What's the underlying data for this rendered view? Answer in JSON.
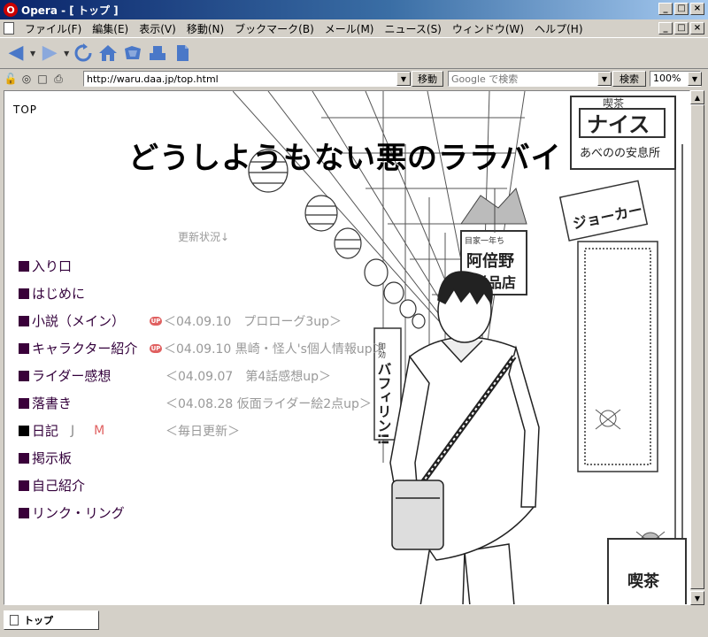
{
  "window": {
    "title": "Opera - [ トップ ]",
    "app_icon_letter": "O",
    "min_glyph": "_",
    "max_glyph": "□",
    "close_glyph": "×"
  },
  "menu": {
    "items": [
      "ファイル(F)",
      "編集(E)",
      "表示(V)",
      "移動(N)",
      "ブックマーク(B)",
      "メール(M)",
      "ニュース(S)",
      "ウィンドウ(W)",
      "ヘルプ(H)"
    ]
  },
  "address_bar": {
    "url": "http://waru.daa.jp/top.html",
    "go_label": "移動",
    "search_placeholder": "Google で検索",
    "search_button": "検索",
    "zoom": "100%"
  },
  "page": {
    "top_label": "TOP",
    "site_title": "どうしようもない悪のララバイ",
    "update_heading": "更新状況↓",
    "nav": [
      {
        "label": "入り口"
      },
      {
        "label": "はじめに"
      },
      {
        "label": "小説（メイン）",
        "update": "＜04.09.10　プロローグ3up＞",
        "badge": "UP"
      },
      {
        "label": "キャラクター紹介",
        "update": "＜04.09.10 黒崎・怪人's個人情報up＞",
        "badge": "UP"
      },
      {
        "label": "ライダー感想",
        "update": "＜04.09.07　第4話感想up＞"
      },
      {
        "label": "落書き",
        "update": "＜04.08.28 仮面ライダー絵2点up＞"
      },
      {
        "label": "日記",
        "j": "J",
        "m": "M",
        "update": "＜毎日更新＞"
      },
      {
        "label": "掲示板"
      },
      {
        "label": "自己紹介"
      },
      {
        "label": "リンク・リング"
      }
    ]
  },
  "illustration_text": {
    "shop_sign": "ナイス",
    "shop_sign_top": "喫茶",
    "shop_sub": "あべのの安息所",
    "store_name": "阿倍野\n洋品店",
    "banner": "即効バフィリン!!",
    "kissa": "喫茶",
    "side_sign": "ジョーカー",
    "store_small": "目家一年ち"
  },
  "status_bar": {
    "tab_label": "トップ"
  }
}
